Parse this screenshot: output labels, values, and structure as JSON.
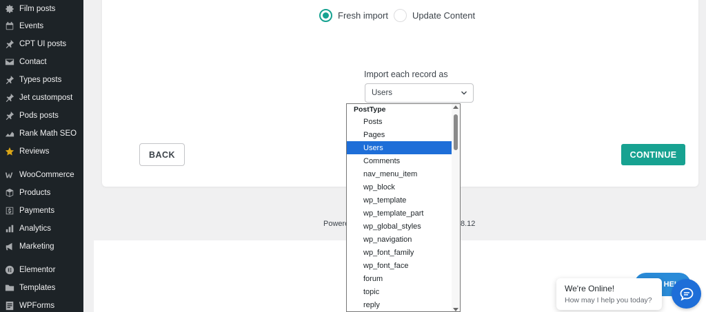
{
  "sidebar": {
    "items": [
      {
        "label": "Film posts",
        "icon": "gear-icon"
      },
      {
        "label": "Events",
        "icon": "calendar-icon"
      },
      {
        "label": "CPT UI posts",
        "icon": "pin-icon"
      },
      {
        "label": "Contact",
        "icon": "mail-icon"
      },
      {
        "label": "Types posts",
        "icon": "pin-icon"
      },
      {
        "label": "Jet custompost",
        "icon": "pin-icon"
      },
      {
        "label": "Pods posts",
        "icon": "pin-icon"
      },
      {
        "label": "Rank Math SEO",
        "icon": "chart-icon"
      },
      {
        "label": "Reviews",
        "icon": "star-icon"
      },
      {
        "label": "WooCommerce",
        "icon": "woo-icon"
      },
      {
        "label": "Products",
        "icon": "box-icon"
      },
      {
        "label": "Payments",
        "icon": "dollar-icon"
      },
      {
        "label": "Analytics",
        "icon": "bar-chart-icon"
      },
      {
        "label": "Marketing",
        "icon": "megaphone-icon"
      },
      {
        "label": "Elementor",
        "icon": "elementor-icon"
      },
      {
        "label": "Templates",
        "icon": "folder-icon"
      },
      {
        "label": "WPForms",
        "icon": "form-icon"
      }
    ]
  },
  "import_mode": {
    "fresh_label": "Fresh import",
    "update_label": "Update Content",
    "selected": "fresh"
  },
  "record_type": {
    "label": "Import each record as",
    "selected_value": "Users",
    "group_label": "PostType",
    "options": [
      "Posts",
      "Pages",
      "Users",
      "Comments",
      "nav_menu_item",
      "wp_block",
      "wp_template",
      "wp_template_part",
      "wp_global_styles",
      "wp_navigation",
      "wp_font_family",
      "wp_font_face",
      "forum",
      "topic",
      "reply"
    ],
    "selected_index": 2
  },
  "buttons": {
    "back": "BACK",
    "continue": "CONTINUE"
  },
  "footer": {
    "powered_fragment": "Powere",
    "version_fragment": "8.12"
  },
  "chat": {
    "help_label": "HELP",
    "title": "We're Online!",
    "subtitle": "How may I help you today?"
  },
  "colors": {
    "accent": "#17a291",
    "selection": "#1e6ed8",
    "sidebar_bg": "#1d2327"
  }
}
